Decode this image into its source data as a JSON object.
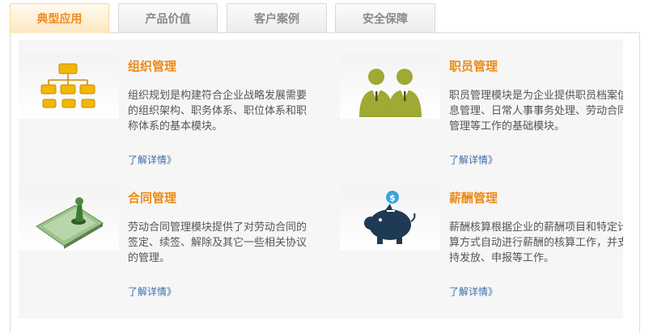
{
  "tabs": [
    {
      "label": "典型应用",
      "active": true
    },
    {
      "label": "产品价值",
      "active": false
    },
    {
      "label": "客户案例",
      "active": false
    },
    {
      "label": "安全保障",
      "active": false
    }
  ],
  "cards": [
    {
      "title": "组织管理",
      "description": "组织规划是构建符合企业战略发展需要的组织架构、职务体系、职位体系和职称体系的基本模块。",
      "more_link": "了解详情》",
      "icon": "org-chart-icon"
    },
    {
      "title": "职员管理",
      "description": "职员管理模块是为企业提供职员档案信息管理、日常人事事务处理、劳动合同管理等工作的基础模块。",
      "more_link": "了解详情》",
      "icon": "employees-icon"
    },
    {
      "title": "合同管理",
      "description": "劳动合同管理模块提供了对劳动合同的签定、续签、解除及其它一些相关协议的管理。",
      "more_link": "了解详情》",
      "icon": "contract-pen-icon"
    },
    {
      "title": "薪酬管理",
      "description": "薪酬核算根据企业的薪酬项目和特定计算方式自动进行薪酬的核算工作，并支持发放、申报等工作。",
      "more_link": "了解详情》",
      "icon": "piggy-bank-icon"
    }
  ],
  "colors": {
    "accent": "#ef8a16",
    "link": "#3a6ea8",
    "text": "#555555"
  }
}
